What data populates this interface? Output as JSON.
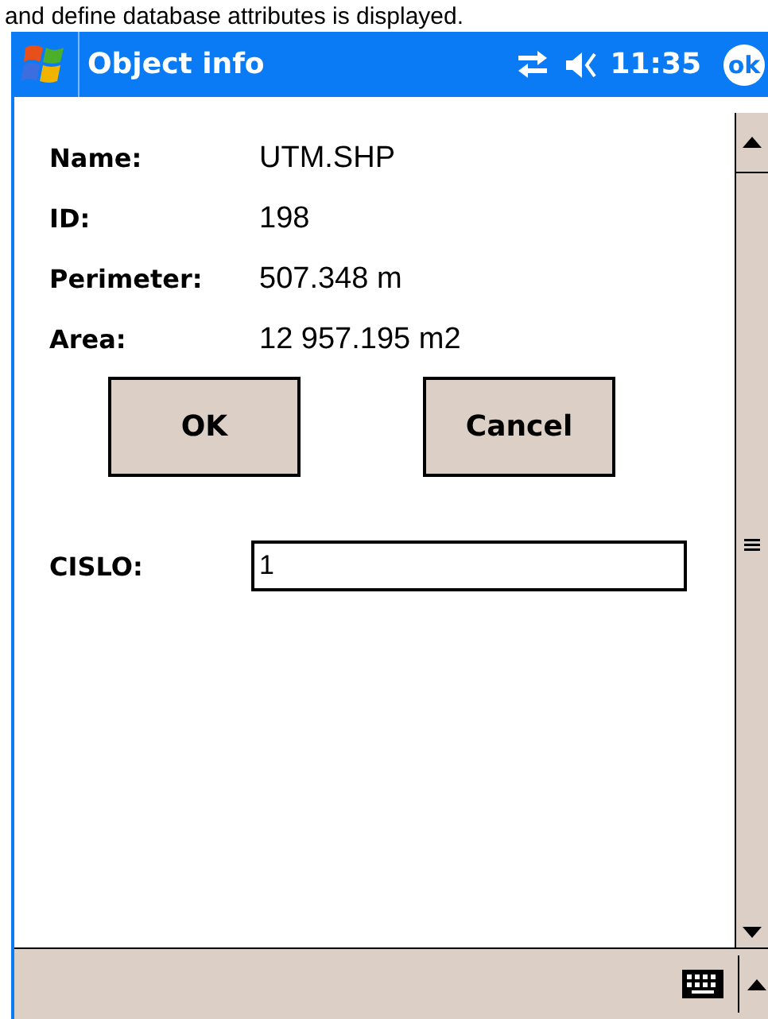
{
  "caption": "and define database attributes is displayed.",
  "title_bar": {
    "title": "Object info",
    "time": "11:35",
    "ok": "ok"
  },
  "fields": [
    {
      "label": "Name:",
      "value": "UTM.SHP"
    },
    {
      "label": "ID:",
      "value": "198"
    },
    {
      "label": "Perimeter:",
      "value": "507.348 m"
    },
    {
      "label": "Area:",
      "value": "12 957.195 m2"
    }
  ],
  "buttons": [
    "OK",
    "Cancel"
  ],
  "attribute": {
    "label": "CISLO:",
    "value": "1"
  }
}
